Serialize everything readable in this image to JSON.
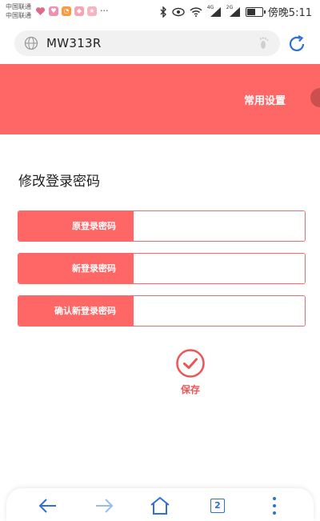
{
  "status_bar": {
    "carrier_1": "中国联通",
    "carrier_2": "中国联通",
    "more": "···",
    "net_label_1": "4G",
    "net_label_2": "2G",
    "time": "傍晚5:11",
    "battery_level": 0.55,
    "icons": [
      "heart-icon",
      "app-icon",
      "weibo-icon",
      "app-icon",
      "app-icon",
      "bluetooth-icon",
      "eye-icon",
      "wifi-icon",
      "signal-icon",
      "signal-icon",
      "battery-icon"
    ]
  },
  "browser": {
    "url": "MW313R",
    "globe_icon": "globe-icon",
    "footprint_icon": "footprint-icon",
    "refresh_icon": "refresh-icon"
  },
  "header": {
    "settings_label": "常用设置"
  },
  "form": {
    "title": "修改登录密码",
    "fields": [
      {
        "label": "原登录密码",
        "value": ""
      },
      {
        "label": "新登录密码",
        "value": ""
      },
      {
        "label": "确认新登录密码",
        "value": ""
      }
    ],
    "save_label": "保存"
  },
  "bottom_nav": {
    "tab_count": "2",
    "icons": [
      "back-icon",
      "forward-icon",
      "home-icon",
      "tabs-icon",
      "menu-icon"
    ]
  },
  "colors": {
    "accent": "#ff6666",
    "link_blue": "#2f6fd6"
  }
}
